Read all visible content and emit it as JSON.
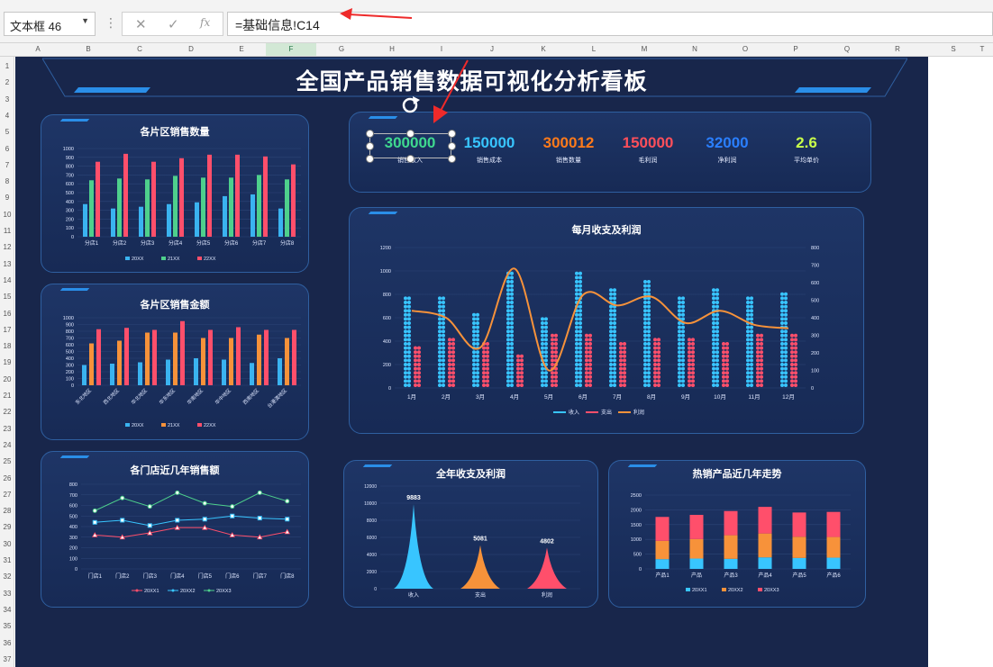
{
  "app": {
    "name_box": "文本框 46",
    "formula": "=基础信息!C14",
    "cancel_icon": "✕",
    "enter_icon": "✓",
    "fx_label": "fx"
  },
  "columns": [
    "A",
    "B",
    "C",
    "D",
    "E",
    "F",
    "G",
    "H",
    "I",
    "J",
    "K",
    "L",
    "M",
    "N",
    "O",
    "P",
    "Q",
    "R",
    "S",
    "T"
  ],
  "rows": [
    "1",
    "2",
    "3",
    "4",
    "5",
    "6",
    "7",
    "8",
    "9",
    "10",
    "11",
    "12",
    "13",
    "14",
    "15",
    "16",
    "17",
    "18",
    "19",
    "20",
    "21",
    "22",
    "23",
    "24",
    "25",
    "26",
    "27",
    "28",
    "29",
    "30",
    "31",
    "32",
    "33",
    "34",
    "35",
    "36",
    "37"
  ],
  "dashboard": {
    "title": "全国产品销售数据可视化分析看板"
  },
  "colors": {
    "s1": "#3ab3f0",
    "s2": "#4ed08c",
    "s3": "#ff4f6b",
    "orange": "#f7923a",
    "income": "#38c5ff",
    "expense": "#ff4f6b",
    "profit": "#f7923a"
  },
  "kpis": [
    {
      "value": "300000",
      "label": "销售收入",
      "color": "#3fd98f"
    },
    {
      "value": "150000",
      "label": "销售成本",
      "color": "#38c5ff"
    },
    {
      "value": "300012",
      "label": "销售数量",
      "color": "#ff7a1a"
    },
    {
      "value": "150000",
      "label": "毛利润",
      "color": "#ff4f5a"
    },
    {
      "value": "32000",
      "label": "净利润",
      "color": "#2a7fff"
    },
    {
      "value": "2.6",
      "label": "平均单价",
      "color": "#c9ff4a"
    }
  ],
  "chart_data": [
    {
      "id": "region_qty",
      "type": "bar",
      "title": "各片区销售数量",
      "categories": [
        "分店1",
        "分店2",
        "分店3",
        "分店4",
        "分店5",
        "分店6",
        "分店7",
        "分店8"
      ],
      "ylim": [
        0,
        1000
      ],
      "yticks": [
        0,
        100,
        200,
        300,
        400,
        500,
        600,
        700,
        800,
        900,
        1000
      ],
      "series": [
        {
          "name": "20XX",
          "values": [
            370,
            320,
            340,
            370,
            390,
            460,
            480,
            320
          ]
        },
        {
          "name": "21XX",
          "values": [
            640,
            660,
            650,
            690,
            670,
            670,
            700,
            650
          ]
        },
        {
          "name": "22XX",
          "values": [
            850,
            940,
            850,
            890,
            930,
            930,
            910,
            820
          ]
        }
      ]
    },
    {
      "id": "region_amt",
      "type": "bar",
      "title": "各片区销售金额",
      "categories": [
        "东北地区",
        "西北地区",
        "华北地区",
        "华东地区",
        "华南地区",
        "华中地区",
        "西南地区",
        "台港澳地区"
      ],
      "ylim": [
        0,
        1000
      ],
      "yticks": [
        0,
        100,
        200,
        300,
        400,
        500,
        600,
        700,
        800,
        900,
        1000
      ],
      "series": [
        {
          "name": "20XX",
          "values": [
            300,
            320,
            340,
            380,
            400,
            380,
            330,
            400
          ]
        },
        {
          "name": "21XX",
          "values": [
            620,
            660,
            780,
            780,
            700,
            700,
            750,
            700
          ]
        },
        {
          "name": "22XX",
          "values": [
            830,
            850,
            820,
            950,
            820,
            860,
            820,
            820
          ]
        }
      ]
    },
    {
      "id": "store_sales",
      "type": "line",
      "title": "各门店近几年销售额",
      "categories": [
        "门店1",
        "门店2",
        "门店3",
        "门店4",
        "门店5",
        "门店6",
        "门店7",
        "门店8"
      ],
      "ylim": [
        0,
        800
      ],
      "yticks": [
        0,
        100,
        200,
        300,
        400,
        500,
        600,
        700,
        800
      ],
      "series": [
        {
          "name": "20XX1",
          "values": [
            320,
            300,
            340,
            390,
            390,
            320,
            300,
            350
          ]
        },
        {
          "name": "20XX2",
          "values": [
            440,
            460,
            410,
            460,
            470,
            500,
            480,
            470
          ]
        },
        {
          "name": "20XX3",
          "values": [
            550,
            670,
            590,
            720,
            620,
            590,
            720,
            640
          ]
        }
      ]
    },
    {
      "id": "monthly",
      "type": "bar",
      "title": "每月收支及利润",
      "categories": [
        "1月",
        "2月",
        "3月",
        "4月",
        "5月",
        "6月",
        "7月",
        "8月",
        "9月",
        "10月",
        "11月",
        "12月"
      ],
      "ylim": [
        0,
        1200
      ],
      "y2lim": [
        0,
        800
      ],
      "yticks": [
        0,
        200,
        400,
        600,
        800,
        1000,
        1200
      ],
      "y2ticks": [
        0,
        100,
        200,
        300,
        400,
        500,
        600,
        700,
        800
      ],
      "series": [
        {
          "name": "收入",
          "values": [
            780,
            800,
            630,
            990,
            600,
            990,
            850,
            930,
            780,
            840,
            800,
            810
          ]
        },
        {
          "name": "支出",
          "values": [
            370,
            430,
            380,
            290,
            480,
            470,
            380,
            420,
            430,
            410,
            450,
            470
          ]
        },
        {
          "name": "利润",
          "values": [
            440,
            400,
            230,
            680,
            100,
            530,
            470,
            520,
            370,
            440,
            360,
            340
          ]
        }
      ]
    },
    {
      "id": "annual",
      "type": "area",
      "title": "全年收支及利润",
      "categories": [
        "收入",
        "支出",
        "利润"
      ],
      "values": [
        9883,
        5081,
        4802
      ],
      "ylim": [
        0,
        12000
      ],
      "yticks": [
        0,
        2000,
        4000,
        6000,
        8000,
        10000,
        12000
      ]
    },
    {
      "id": "hot_products",
      "type": "bar",
      "title": "热销产品近几年走势",
      "categories": [
        "产品1",
        "产品",
        "产品3",
        "产品4",
        "产品5",
        "产品6"
      ],
      "ylim": [
        0,
        2500
      ],
      "yticks": [
        0,
        500,
        1000,
        1500,
        2000,
        2500
      ],
      "series": [
        {
          "name": "20XX1",
          "values": [
            330,
            350,
            340,
            390,
            370,
            380
          ]
        },
        {
          "name": "20XX2",
          "values": [
            620,
            660,
            800,
            810,
            720,
            700
          ]
        },
        {
          "name": "20XX3",
          "values": [
            810,
            820,
            820,
            900,
            820,
            850
          ]
        }
      ]
    }
  ]
}
